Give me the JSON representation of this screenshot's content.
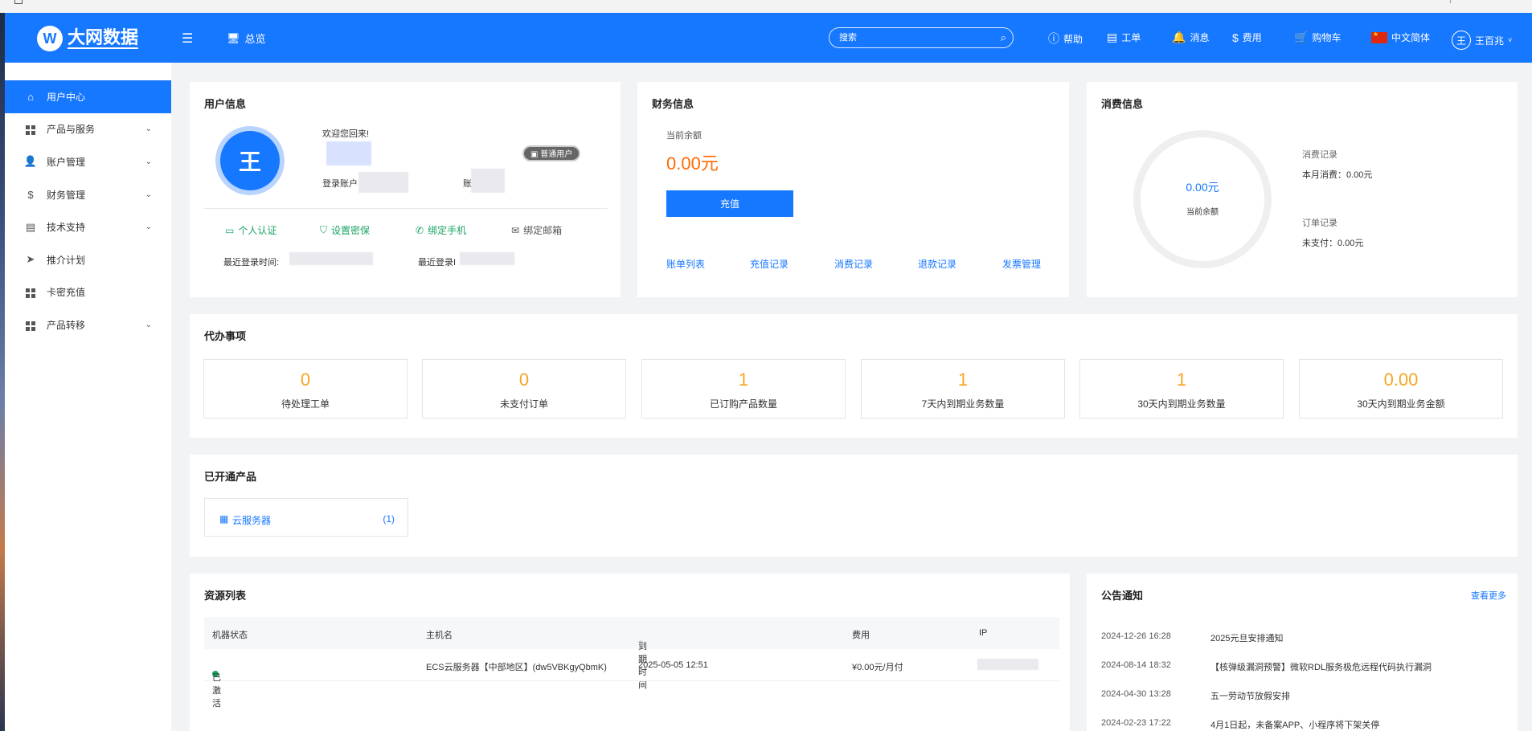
{
  "header": {
    "logo_mark": "W",
    "logo_text": "大网数据",
    "overview": "总览",
    "search_placeholder": "搜索",
    "nav": [
      "帮助",
      "工单",
      "消息",
      "费用",
      "购物车"
    ],
    "language": "中文简体",
    "user_initial": "王",
    "user_name": "王百兆"
  },
  "sidebar": {
    "items": [
      {
        "label": "用户中心",
        "icon": "home-icon"
      },
      {
        "label": "产品与服务",
        "icon": "grid-icon"
      },
      {
        "label": "账户管理",
        "icon": "user-icon"
      },
      {
        "label": "财务管理",
        "icon": "dollar-icon"
      },
      {
        "label": "技术支持",
        "icon": "doc-icon"
      },
      {
        "label": "推介计划",
        "icon": "send-icon"
      },
      {
        "label": "卡密充值",
        "icon": "grid-icon"
      },
      {
        "label": "产品转移",
        "icon": "grid-icon"
      }
    ]
  },
  "user_info": {
    "title": "用户信息",
    "avatar_initial": "王",
    "welcome": "欢迎您回来!",
    "login_account_label": "登录账户",
    "account_label": "账",
    "user_type": "普通用户",
    "auth_links": [
      "个人认证",
      "设置密保",
      "绑定手机",
      "绑定邮箱"
    ],
    "last_login_time_label": "最近登录时间:",
    "last_login_ip_label": "最近登录I"
  },
  "finance": {
    "title": "财务信息",
    "balance_label": "当前余额",
    "balance": "0.00元",
    "recharge_button": "充值",
    "links": [
      "账单列表",
      "充值记录",
      "消费记录",
      "退款记录",
      "发票管理"
    ]
  },
  "consumption": {
    "title": "消费信息",
    "ring_value": "0.00元",
    "ring_label": "当前余额",
    "consume_title": "消费记录",
    "consume_value": "本月消费：0.00元",
    "order_title": "订单记录",
    "order_value": "未支付：0.00元"
  },
  "todo": {
    "title": "代办事项",
    "items": [
      {
        "value": "0",
        "label": "待处理工单"
      },
      {
        "value": "0",
        "label": "未支付订单"
      },
      {
        "value": "1",
        "label": "已订购产品数量"
      },
      {
        "value": "1",
        "label": "7天内到期业务数量"
      },
      {
        "value": "1",
        "label": "30天内到期业务数量"
      },
      {
        "value": "0.00",
        "label": "30天内到期业务金额"
      }
    ]
  },
  "products": {
    "title": "已开通产品",
    "items": [
      {
        "name": "云服务器",
        "count": "(1)"
      }
    ]
  },
  "resources": {
    "title": "资源列表",
    "columns": [
      "机器状态",
      "主机名",
      "到期时间",
      "费用",
      "IP"
    ],
    "rows": [
      {
        "status": "已激活",
        "host": "ECS云服务器【中部地区】(dw5VBKgyQbmK)",
        "expire": "2025-05-05 12:51",
        "fee": "¥0.00元/月付",
        "ip": ""
      }
    ]
  },
  "notices": {
    "title": "公告通知",
    "more": "查看更多",
    "items": [
      {
        "date": "2024-12-26 16:28",
        "text": "2025元旦安排通知"
      },
      {
        "date": "2024-08-14 18:32",
        "text": "【核弹级漏洞预警】微软RDL服务极危远程代码执行漏洞"
      },
      {
        "date": "2024-04-30 13:28",
        "text": "五一劳动节放假安排"
      },
      {
        "date": "2024-02-23 17:22",
        "text": "4月1日起，未备案APP、小程序将下架关停"
      }
    ]
  },
  "colors": {
    "brand": "#1677ff",
    "orange": "#f5a623",
    "balance": "#ff6a00",
    "green": "#19a463"
  }
}
